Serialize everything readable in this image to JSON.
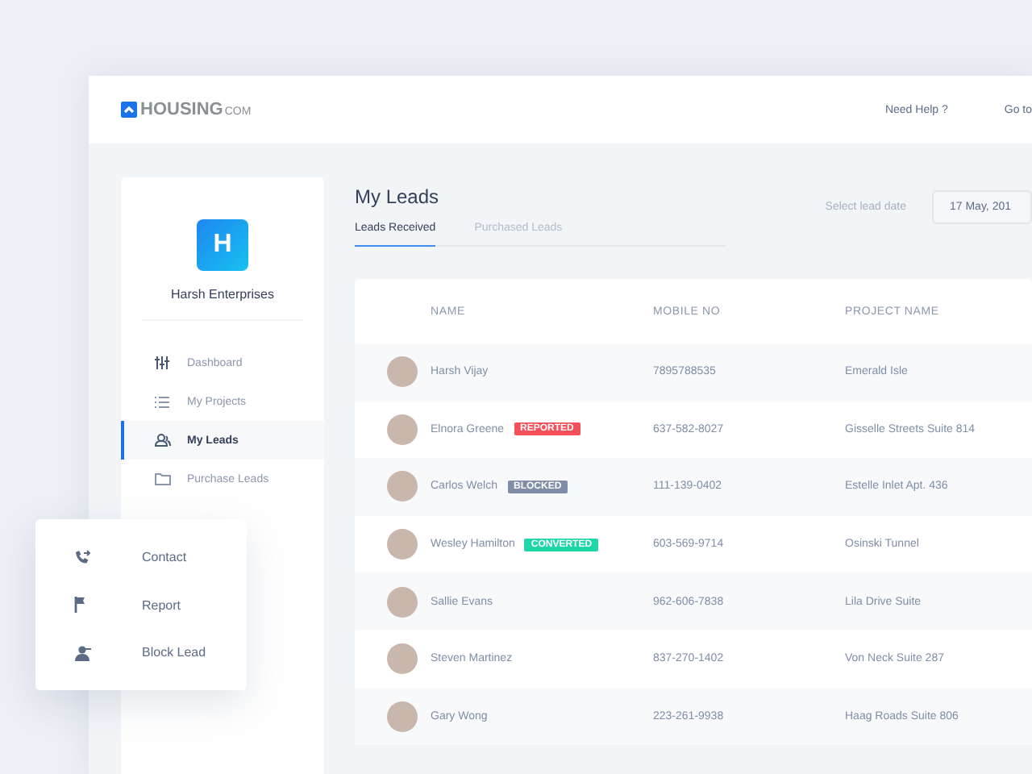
{
  "header": {
    "logo": {
      "main": "HOUSING",
      "suffix": "COM"
    },
    "links": [
      "Need Help ?",
      "Go to"
    ]
  },
  "sidebar": {
    "company_initial": "H",
    "company_name": "Harsh Enterprises",
    "items": [
      {
        "label": "Dashboard",
        "kind": "sliders",
        "selected": false
      },
      {
        "label": "My Projects",
        "kind": "list",
        "selected": false
      },
      {
        "label": "My Leads",
        "kind": "people",
        "selected": true
      },
      {
        "label": "Purchase Leads",
        "kind": "folder",
        "selected": false
      }
    ]
  },
  "page": {
    "title": "My Leads",
    "date_label": "Select lead date",
    "date_value": "17 May, 201",
    "tabs": [
      {
        "label": "Leads Received",
        "selected": true
      },
      {
        "label": "Purchased Leads",
        "selected": false
      }
    ]
  },
  "table": {
    "columns": [
      "NAME",
      "MOBILE NO",
      "PROJECT NAME"
    ],
    "rows": [
      {
        "name": "Harsh Vijay",
        "mobile": "7895788535",
        "project": "Emerald Isle"
      },
      {
        "name": "Elnora Greene",
        "badge": {
          "label": "REPORTED",
          "color": "#f4505a"
        },
        "mobile": "637-582-8027",
        "project": "Gisselle Streets Suite 814"
      },
      {
        "name": "Carlos Welch",
        "badge": {
          "label": "BLOCKED",
          "color": "#7f8ea6"
        },
        "mobile": "111-139-0402",
        "project": "Estelle Inlet Apt. 436"
      },
      {
        "name": "Wesley Hamilton",
        "badge": {
          "label": "CONVERTED",
          "color": "#1fd6a8"
        },
        "mobile": "603-569-9714",
        "project": "Osinski Tunnel"
      },
      {
        "name": "Sallie Evans",
        "mobile": "962-606-7838",
        "project": "Lila Drive Suite"
      },
      {
        "name": "Steven Martinez",
        "mobile": "837-270-1402",
        "project": "Von Neck Suite 287"
      },
      {
        "name": "Gary Wong",
        "mobile": "223-261-9938",
        "project": "Haag Roads Suite 806"
      }
    ]
  },
  "context_menu": {
    "items": [
      {
        "label": "Contact",
        "kind": "phone"
      },
      {
        "label": "Report",
        "kind": "flag"
      },
      {
        "label": "Block Lead",
        "kind": "person"
      }
    ]
  }
}
